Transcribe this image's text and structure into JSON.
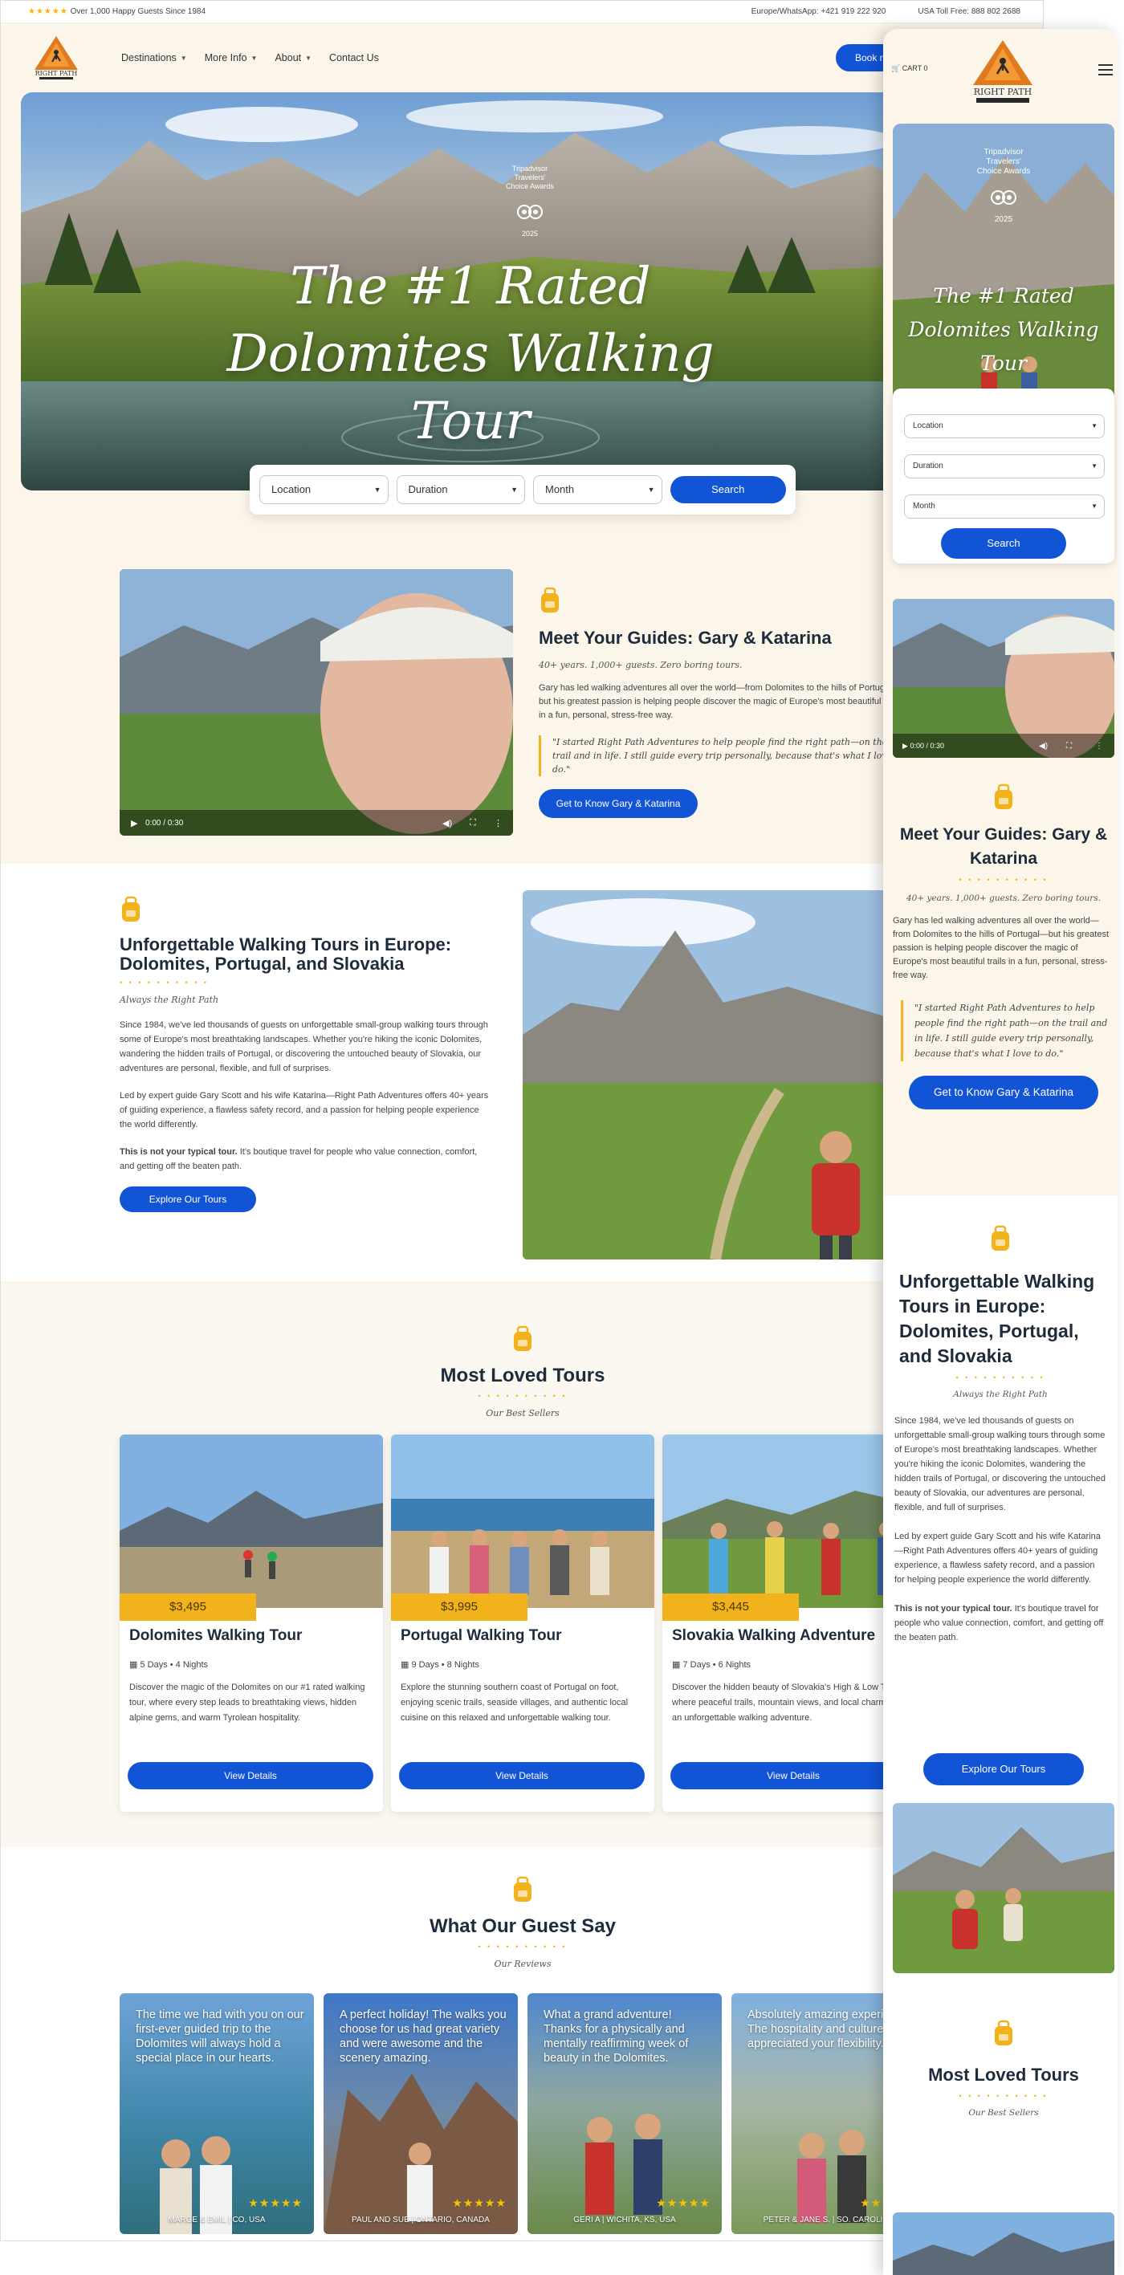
{
  "topbar": {
    "stars": "★★★★★",
    "happy": "Over 1,000 Happy Guests Since 1984",
    "europe": "Europe/WhatsApp: +421 919 222 920",
    "usa": "USA Toll Free: 888 802 2688"
  },
  "nav": {
    "items": [
      "Destinations",
      "More Info",
      "About",
      "Contact Us"
    ],
    "book": "Book n"
  },
  "hero": {
    "award_lines": [
      "Tripadvisor",
      "Travelers'",
      "Choice Awards",
      "2025"
    ],
    "title": "The #1 Rated Dolomites Walking Tour"
  },
  "search": {
    "location": "Location",
    "duration": "Duration",
    "month": "Month",
    "button": "Search"
  },
  "guides": {
    "video_time": "0:00 / 0:30",
    "title": "Meet Your Guides: Gary & Katarina",
    "tagline": "40+ years. 1,000+ guests. Zero boring tours.",
    "body": "Gary has led walking adventures all over the world—from Dolomites to the hills of Portugal—but his greatest passion is helping people discover the magic of Europe's most beautiful trails in a fun, personal, stress-free way.",
    "quote": "\"I started Right Path Adventures to help people find the right path—on the trail and in life. I still guide every trip personally, because that's what I love to do.\"",
    "button": "Get to Know Gary & Katarina"
  },
  "unforgettable": {
    "title": "Unforgettable Walking Tours in Europe: Dolomites, Portugal, and Slovakia",
    "dots": "• • • • • • • • • •",
    "tagline": "Always the Right Path",
    "p1": "Since 1984, we've led thousands of guests on unforgettable small-group walking tours through some of Europe's most breathtaking landscapes. Whether you're hiking the iconic Dolomites, wandering the hidden trails of Portugal, or discovering the untouched beauty of Slovakia, our adventures are personal, flexible, and full of surprises.",
    "p2": "Led by expert guide Gary Scott and his wife Katarina—Right Path Adventures offers 40+ years of guiding experience, a flawless safety record, and a passion for helping people experience the world differently.",
    "p3_bold": "This is not your typical tour.",
    "p3": " It's boutique travel for people who value connection, comfort, and getting off the beaten path.",
    "button": "Explore Our Tours"
  },
  "loved": {
    "title": "Most Loved Tours",
    "tagline": "Our Best Sellers",
    "cards": [
      {
        "price": "$3,495",
        "title": "Dolomites Walking Tour",
        "duration": "5 Days • 4 Nights",
        "desc": "Discover the magic of the Dolomites on our #1 rated walking tour, where every step leads to breathtaking views, hidden alpine gems, and warm Tyrolean hospitality.",
        "button": "View Details"
      },
      {
        "price": "$3,995",
        "title": "Portugal Walking Tour",
        "duration": "9 Days • 8 Nights",
        "desc": "Explore the stunning southern coast of Portugal on foot, enjoying scenic trails, seaside villages, and authentic local cuisine on this relaxed and unforgettable walking tour.",
        "button": "View Details"
      },
      {
        "price": "$3,445",
        "title": "Slovakia Walking Adventure",
        "duration": "7 Days • 6 Nights",
        "desc": "Discover the hidden beauty of Slovakia's High & Low Tatras, where peaceful trails, mountain views, and local charm create an unforgettable walking adventure.",
        "button": "View Details"
      }
    ]
  },
  "reviews": {
    "title": "What Our Guest Say",
    "tagline": "Our Reviews",
    "items": [
      {
        "text": "The time we had with you on our first-ever guided trip to the Dolomites will always hold a special place in our hearts.",
        "stars": "★★★★★",
        "who": "MARGE & EMIL | CO, USA"
      },
      {
        "text": "A perfect holiday! The walks you choose for us had great variety and were awesome and the scenery amazing.",
        "stars": "★★★★★",
        "who": "PAUL AND SUE | ONTARIO, CANADA"
      },
      {
        "text": "What a grand adventure! Thanks for a physically and mentally reaffirming week of beauty in the Dolomites.",
        "stars": "★★★★★",
        "who": "GERI A | WICHITA, KS, USA"
      },
      {
        "text": "Absolutely amazing experience! The hospitality and culture! We appreciated your flexibility...",
        "stars": "★★★★★",
        "who": "PETER & JANE S. | SO. CAROLINA"
      }
    ]
  },
  "mobile": {
    "cart": "CART",
    "cart_count": "0",
    "award_lines": [
      "Tripadvisor",
      "Travelers'",
      "Choice Awards",
      "2025"
    ],
    "hero_title": "The #1 Rated Dolomites Walking Tour",
    "location": "Location",
    "duration": "Duration",
    "month": "Month",
    "search": "Search",
    "video_time": "0:00 / 0:30"
  },
  "colors": {
    "accent": "#1254d6",
    "gold": "#f2b21c",
    "cream": "#fbf5ea",
    "heading": "#1d2b3a"
  }
}
